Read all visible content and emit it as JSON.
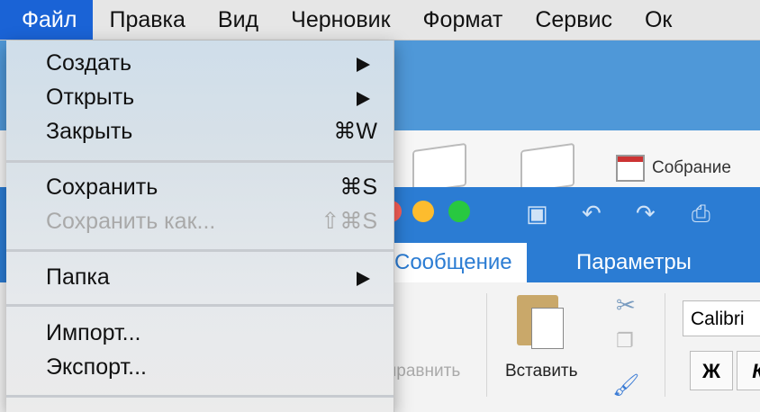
{
  "menubar": {
    "items": [
      "Файл",
      "Правка",
      "Вид",
      "Черновик",
      "Формат",
      "Сервис",
      "Ок"
    ]
  },
  "background": {
    "meeting_label": "Собрание",
    "tabs": [
      "Сообщение",
      "Параметры"
    ],
    "send_label": "правнить",
    "paste_label": "Вставить",
    "font_name": "Calibri",
    "bold_label": "Ж",
    "italic_label": "К"
  },
  "file_menu": {
    "items": [
      {
        "label": "Создать",
        "submenu": true
      },
      {
        "label": "Открыть",
        "submenu": true
      },
      {
        "label": "Закрыть",
        "shortcut": "⌘W"
      },
      {
        "label": "Сохранить",
        "shortcut": "⌘S"
      },
      {
        "label": "Сохранить как...",
        "shortcut": "⇧⌘S",
        "disabled": true
      },
      {
        "label": "Папка",
        "submenu": true
      },
      {
        "label": "Импорт..."
      },
      {
        "label": "Экспорт..."
      }
    ]
  },
  "colors": {
    "accent": "#1a63d6",
    "outlook_blue": "#2b7cd3",
    "close_dot": "#fc5f57",
    "min_dot": "#fdbc2e",
    "max_dot": "#28c840"
  }
}
